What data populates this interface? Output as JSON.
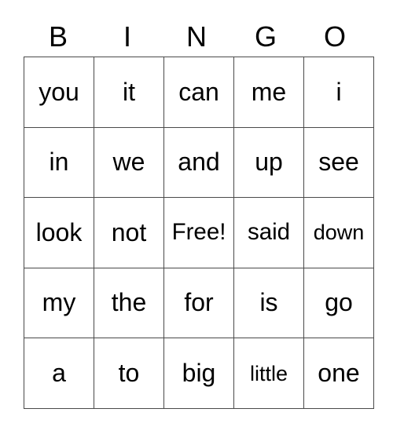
{
  "card": {
    "title": "BINGO",
    "header_letters": [
      "B",
      "I",
      "N",
      "G",
      "O"
    ],
    "columns": 5,
    "rows": 5,
    "colors": {
      "background": "#ffffff",
      "grid_line": "#4a4a4a",
      "text": "#000000"
    },
    "free_space": {
      "label": "Free!",
      "row": 3,
      "column": 3
    },
    "grid": [
      [
        {
          "text": "you",
          "size": "normal"
        },
        {
          "text": "it",
          "size": "normal"
        },
        {
          "text": "can",
          "size": "normal"
        },
        {
          "text": "me",
          "size": "normal"
        },
        {
          "text": "i",
          "size": "normal"
        }
      ],
      [
        {
          "text": "in",
          "size": "normal"
        },
        {
          "text": "we",
          "size": "normal"
        },
        {
          "text": "and",
          "size": "normal"
        },
        {
          "text": "up",
          "size": "normal"
        },
        {
          "text": "see",
          "size": "normal"
        }
      ],
      [
        {
          "text": "look",
          "size": "normal"
        },
        {
          "text": "not",
          "size": "normal"
        },
        {
          "text": "Free!",
          "size": "medium"
        },
        {
          "text": "said",
          "size": "medium"
        },
        {
          "text": "down",
          "size": "small"
        }
      ],
      [
        {
          "text": "my",
          "size": "normal"
        },
        {
          "text": "the",
          "size": "normal"
        },
        {
          "text": "for",
          "size": "normal"
        },
        {
          "text": "is",
          "size": "normal"
        },
        {
          "text": "go",
          "size": "normal"
        }
      ],
      [
        {
          "text": "a",
          "size": "normal"
        },
        {
          "text": "to",
          "size": "normal"
        },
        {
          "text": "big",
          "size": "normal"
        },
        {
          "text": "little",
          "size": "small"
        },
        {
          "text": "one",
          "size": "normal"
        }
      ]
    ]
  }
}
